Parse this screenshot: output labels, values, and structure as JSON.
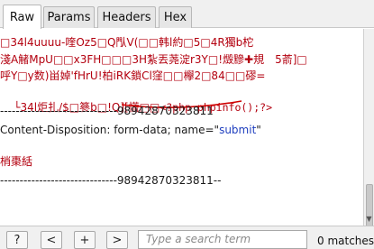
{
  "tabs": [
    "Raw",
    "Params",
    "Headers",
    "Hex"
  ],
  "active_tab": "Raw",
  "editor": {
    "line1": "□34l4uuuu-喹Oz5□Q閄V(□□韩l約□5□4R獨b柁",
    "line2": "淺A觰MpU□□x3FH□□□3H紮丟荛淀r3Y□!燬黲✚規　5萮]□",
    "line3": "呼Y□y数)畄婥'fHrU!柏iRK鎖Cl窪□□欅2□84□□磟=",
    "line4_prefix": "└34l炬扎/$□篸b□!Q][慌□□",
    "php_payload": "<?php phpinfo();?>",
    "line5": "------------------------------98942870323811",
    "line6_key": "Content-Disposition: form-data; name=\"",
    "line6_value": "submit",
    "line6_suffix": "\"",
    "line8": "梢棗絬",
    "line9": "------------------------------98942870323811--"
  },
  "bottom": {
    "help": "?",
    "prev": "<",
    "add": "+",
    "next": ">",
    "search_placeholder": "Type a search term",
    "matches": "0 matches"
  },
  "colors": {
    "garbled": "#b3000f",
    "annotation": "#d00000",
    "value": "#1f3fbf"
  }
}
